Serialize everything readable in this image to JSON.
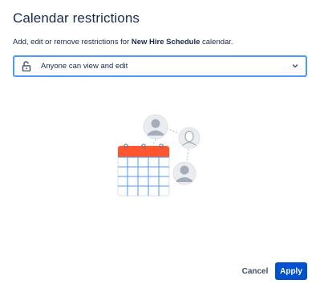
{
  "dialog": {
    "title": "Calendar restrictions",
    "description_prefix": "Add, edit or remove restrictions for ",
    "calendar_name": "New Hire Schedule",
    "description_suffix": " calendar."
  },
  "restriction_select": {
    "selected_value": "Anyone can view and edit",
    "icon": "unlock-icon",
    "chevron_icon": "chevron-down-icon"
  },
  "illustration": {
    "icon": "calendar-with-users-illustration",
    "colors": {
      "calendar_header": "#ff5630",
      "calendar_grid": "#4c9aff",
      "avatar": "#c1c7d0"
    }
  },
  "footer": {
    "cancel_label": "Cancel",
    "apply_label": "Apply"
  },
  "colors": {
    "primary": "#0052cc",
    "focus_border": "#4c9aff",
    "text": "#172b4d"
  }
}
